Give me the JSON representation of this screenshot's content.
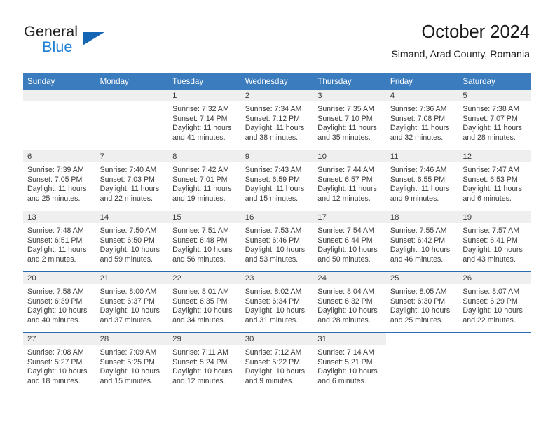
{
  "brand": {
    "name_top": "General",
    "name_bottom": "Blue",
    "flag_icon": "triangle-flag-icon",
    "accent_color": "#1c7fd4"
  },
  "header": {
    "title": "October 2024",
    "subtitle": "Simand, Arad County, Romania"
  },
  "theme": {
    "header_blue": "#3a7cbe",
    "separator_blue": "#2a6cb0",
    "band_gray": "#efefef"
  },
  "calendar": {
    "weekday_headers": [
      "Sunday",
      "Monday",
      "Tuesday",
      "Wednesday",
      "Thursday",
      "Friday",
      "Saturday"
    ],
    "weeks": [
      [
        {
          "day": "",
          "type": "blank"
        },
        {
          "day": "",
          "type": "blank"
        },
        {
          "day": "1",
          "sunrise": "Sunrise: 7:32 AM",
          "sunset": "Sunset: 7:14 PM",
          "daylight1": "Daylight: 11 hours",
          "daylight2": "and 41 minutes."
        },
        {
          "day": "2",
          "sunrise": "Sunrise: 7:34 AM",
          "sunset": "Sunset: 7:12 PM",
          "daylight1": "Daylight: 11 hours",
          "daylight2": "and 38 minutes."
        },
        {
          "day": "3",
          "sunrise": "Sunrise: 7:35 AM",
          "sunset": "Sunset: 7:10 PM",
          "daylight1": "Daylight: 11 hours",
          "daylight2": "and 35 minutes."
        },
        {
          "day": "4",
          "sunrise": "Sunrise: 7:36 AM",
          "sunset": "Sunset: 7:08 PM",
          "daylight1": "Daylight: 11 hours",
          "daylight2": "and 32 minutes."
        },
        {
          "day": "5",
          "sunrise": "Sunrise: 7:38 AM",
          "sunset": "Sunset: 7:07 PM",
          "daylight1": "Daylight: 11 hours",
          "daylight2": "and 28 minutes."
        }
      ],
      [
        {
          "day": "6",
          "sunrise": "Sunrise: 7:39 AM",
          "sunset": "Sunset: 7:05 PM",
          "daylight1": "Daylight: 11 hours",
          "daylight2": "and 25 minutes."
        },
        {
          "day": "7",
          "sunrise": "Sunrise: 7:40 AM",
          "sunset": "Sunset: 7:03 PM",
          "daylight1": "Daylight: 11 hours",
          "daylight2": "and 22 minutes."
        },
        {
          "day": "8",
          "sunrise": "Sunrise: 7:42 AM",
          "sunset": "Sunset: 7:01 PM",
          "daylight1": "Daylight: 11 hours",
          "daylight2": "and 19 minutes."
        },
        {
          "day": "9",
          "sunrise": "Sunrise: 7:43 AM",
          "sunset": "Sunset: 6:59 PM",
          "daylight1": "Daylight: 11 hours",
          "daylight2": "and 15 minutes."
        },
        {
          "day": "10",
          "sunrise": "Sunrise: 7:44 AM",
          "sunset": "Sunset: 6:57 PM",
          "daylight1": "Daylight: 11 hours",
          "daylight2": "and 12 minutes."
        },
        {
          "day": "11",
          "sunrise": "Sunrise: 7:46 AM",
          "sunset": "Sunset: 6:55 PM",
          "daylight1": "Daylight: 11 hours",
          "daylight2": "and 9 minutes."
        },
        {
          "day": "12",
          "sunrise": "Sunrise: 7:47 AM",
          "sunset": "Sunset: 6:53 PM",
          "daylight1": "Daylight: 11 hours",
          "daylight2": "and 6 minutes."
        }
      ],
      [
        {
          "day": "13",
          "sunrise": "Sunrise: 7:48 AM",
          "sunset": "Sunset: 6:51 PM",
          "daylight1": "Daylight: 11 hours",
          "daylight2": "and 2 minutes."
        },
        {
          "day": "14",
          "sunrise": "Sunrise: 7:50 AM",
          "sunset": "Sunset: 6:50 PM",
          "daylight1": "Daylight: 10 hours",
          "daylight2": "and 59 minutes."
        },
        {
          "day": "15",
          "sunrise": "Sunrise: 7:51 AM",
          "sunset": "Sunset: 6:48 PM",
          "daylight1": "Daylight: 10 hours",
          "daylight2": "and 56 minutes."
        },
        {
          "day": "16",
          "sunrise": "Sunrise: 7:53 AM",
          "sunset": "Sunset: 6:46 PM",
          "daylight1": "Daylight: 10 hours",
          "daylight2": "and 53 minutes."
        },
        {
          "day": "17",
          "sunrise": "Sunrise: 7:54 AM",
          "sunset": "Sunset: 6:44 PM",
          "daylight1": "Daylight: 10 hours",
          "daylight2": "and 50 minutes."
        },
        {
          "day": "18",
          "sunrise": "Sunrise: 7:55 AM",
          "sunset": "Sunset: 6:42 PM",
          "daylight1": "Daylight: 10 hours",
          "daylight2": "and 46 minutes."
        },
        {
          "day": "19",
          "sunrise": "Sunrise: 7:57 AM",
          "sunset": "Sunset: 6:41 PM",
          "daylight1": "Daylight: 10 hours",
          "daylight2": "and 43 minutes."
        }
      ],
      [
        {
          "day": "20",
          "sunrise": "Sunrise: 7:58 AM",
          "sunset": "Sunset: 6:39 PM",
          "daylight1": "Daylight: 10 hours",
          "daylight2": "and 40 minutes."
        },
        {
          "day": "21",
          "sunrise": "Sunrise: 8:00 AM",
          "sunset": "Sunset: 6:37 PM",
          "daylight1": "Daylight: 10 hours",
          "daylight2": "and 37 minutes."
        },
        {
          "day": "22",
          "sunrise": "Sunrise: 8:01 AM",
          "sunset": "Sunset: 6:35 PM",
          "daylight1": "Daylight: 10 hours",
          "daylight2": "and 34 minutes."
        },
        {
          "day": "23",
          "sunrise": "Sunrise: 8:02 AM",
          "sunset": "Sunset: 6:34 PM",
          "daylight1": "Daylight: 10 hours",
          "daylight2": "and 31 minutes."
        },
        {
          "day": "24",
          "sunrise": "Sunrise: 8:04 AM",
          "sunset": "Sunset: 6:32 PM",
          "daylight1": "Daylight: 10 hours",
          "daylight2": "and 28 minutes."
        },
        {
          "day": "25",
          "sunrise": "Sunrise: 8:05 AM",
          "sunset": "Sunset: 6:30 PM",
          "daylight1": "Daylight: 10 hours",
          "daylight2": "and 25 minutes."
        },
        {
          "day": "26",
          "sunrise": "Sunrise: 8:07 AM",
          "sunset": "Sunset: 6:29 PM",
          "daylight1": "Daylight: 10 hours",
          "daylight2": "and 22 minutes."
        }
      ],
      [
        {
          "day": "27",
          "sunrise": "Sunrise: 7:08 AM",
          "sunset": "Sunset: 5:27 PM",
          "daylight1": "Daylight: 10 hours",
          "daylight2": "and 18 minutes."
        },
        {
          "day": "28",
          "sunrise": "Sunrise: 7:09 AM",
          "sunset": "Sunset: 5:25 PM",
          "daylight1": "Daylight: 10 hours",
          "daylight2": "and 15 minutes."
        },
        {
          "day": "29",
          "sunrise": "Sunrise: 7:11 AM",
          "sunset": "Sunset: 5:24 PM",
          "daylight1": "Daylight: 10 hours",
          "daylight2": "and 12 minutes."
        },
        {
          "day": "30",
          "sunrise": "Sunrise: 7:12 AM",
          "sunset": "Sunset: 5:22 PM",
          "daylight1": "Daylight: 10 hours",
          "daylight2": "and 9 minutes."
        },
        {
          "day": "31",
          "sunrise": "Sunrise: 7:14 AM",
          "sunset": "Sunset: 5:21 PM",
          "daylight1": "Daylight: 10 hours",
          "daylight2": "and 6 minutes."
        },
        {
          "day": "",
          "type": "void"
        },
        {
          "day": "",
          "type": "void"
        }
      ]
    ]
  }
}
